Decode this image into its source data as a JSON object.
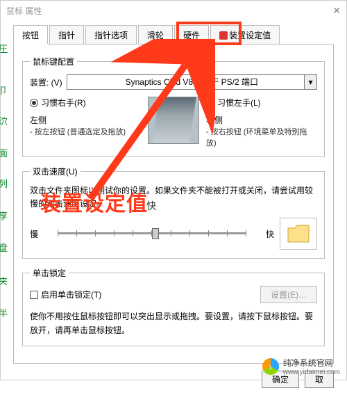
{
  "window": {
    "title": "鼠标 属性"
  },
  "tabs": [
    {
      "label": "按钮",
      "active": true
    },
    {
      "label": "指针"
    },
    {
      "label": "指针选项"
    },
    {
      "label": "滑轮"
    },
    {
      "label": "硬件"
    },
    {
      "label": "装置设定值",
      "icon": true
    }
  ],
  "highlight_tab_index": 5,
  "device_group": {
    "legend": "鼠标键配置",
    "device_label": "装置: (V)",
    "device_value": "Synaptics Cli        d V8.1 位于 PS/2 端口",
    "right_hand": {
      "label": "习惯右手(R)",
      "checked": true
    },
    "left_hand": {
      "label": "习惯左手(L)",
      "checked": false
    },
    "left_side": {
      "title": "左侧",
      "desc": "- 按左按钮 (普通选定及拖放)"
    },
    "right_side": {
      "title": "右侧",
      "desc": "- 按右按钮 (环境菜单及特别拖放)"
    }
  },
  "doubleclick": {
    "legend": "双击速度(U)",
    "desc": "双击文件夹图标以测试你的设置。如果文件夹不能被打开或关闭，请尝试用较慢的双击速度设定。",
    "slow_label": "慢",
    "fast_label": "快"
  },
  "clicklock": {
    "legend": "单击锁定",
    "enable_label": "启用单击锁定(T)",
    "settings_btn": "设置(E)…",
    "desc": "使你不用按住鼠标按钮即可以突出显示或拖拽。要设置，请按下鼠标按钮。要放开，请再单击鼠标按钮。"
  },
  "buttons": {
    "ok": "确定",
    "cancel": "取"
  },
  "overlay": {
    "main_text": "装置设定值",
    "trailing": "快"
  },
  "watermark": {
    "brand": "纯净系统官网",
    "url": "www.yidaimei.com"
  },
  "left_edge_chars": [
    "圧",
    "卩",
    "泬",
    "面",
    "列",
    "享",
    "盘",
    "夹",
    "半"
  ]
}
